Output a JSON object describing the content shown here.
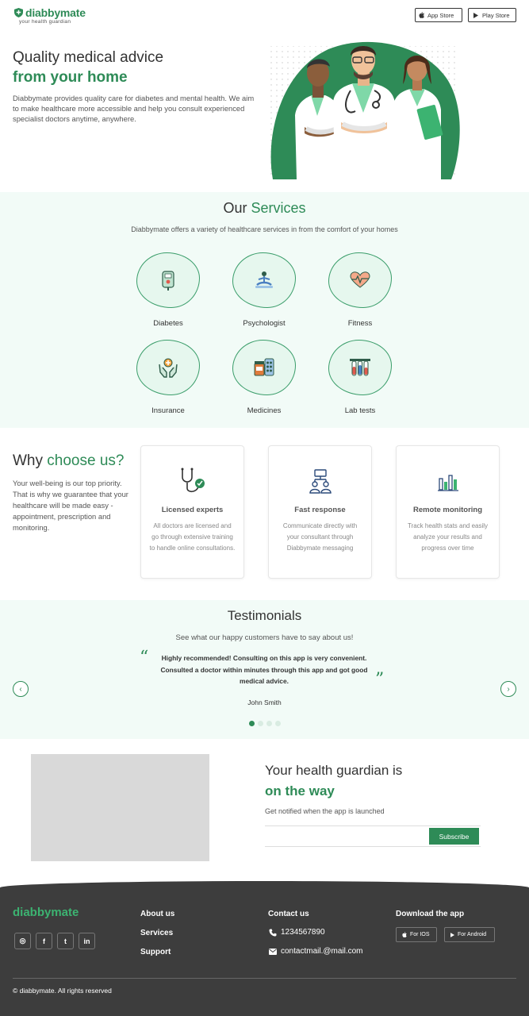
{
  "header": {
    "logo": {
      "prefix": "diabby",
      "suffix": "mate"
    },
    "tagline": "your health guardian",
    "app_store": "App Store",
    "play_store": "Play Store"
  },
  "hero": {
    "title_line1": "Quality medical advice",
    "title_line2": "from your home",
    "description": "Diabbymate provides quality care for diabetes and mental health. We aim to make healthcare more accessible and help you consult experienced specialist doctors anytime, anywhere."
  },
  "services": {
    "title_plain": "Our ",
    "title_accent": "Services",
    "subtitle": "Diabbymate offers a variety of healthcare services in from the comfort of your homes",
    "items": [
      {
        "label": "Diabetes",
        "icon": "glucometer-icon"
      },
      {
        "label": "Psychologist",
        "icon": "meditation-icon"
      },
      {
        "label": "Fitness",
        "icon": "heartbeat-icon"
      },
      {
        "label": "Insurance",
        "icon": "insurance-hands-icon"
      },
      {
        "label": "Medicines",
        "icon": "medicines-icon"
      },
      {
        "label": "Lab tests",
        "icon": "test-tubes-icon"
      }
    ]
  },
  "why": {
    "title_plain": "Why ",
    "title_accent": "choose us?",
    "description": "Your well-being is our top priority. That is why we guarantee that your healthcare will be made easy - appointment, prescription and monitoring.",
    "cards": [
      {
        "title": "Licensed experts",
        "text": "All doctors are licensed and go through extensive training to handle online consultations.",
        "icon": "stethoscope-icon"
      },
      {
        "title": "Fast response",
        "text": "Communicate directly with your consultant through Diabbymate messaging",
        "icon": "team-network-icon"
      },
      {
        "title": "Remote monitoring",
        "text": "Track health stats and easily analyze your results and progress over time",
        "icon": "bar-chart-icon"
      }
    ]
  },
  "testimonials": {
    "title": "Testimonials",
    "subtitle": "See what our happy customers have to say about us!",
    "quote": "Highly recommended! Consulting on this app is very convenient. Consulted a doctor within minutes through this app and got good medical advice.",
    "author": "John Smith",
    "open_quote": "“",
    "close_quote": "”",
    "prev": "‹",
    "next": "›",
    "slides": 4,
    "active_slide": 1
  },
  "subscribe": {
    "title_line1": "Your health guardian is",
    "title_line2": "on the way",
    "note": "Get notified when the app is launched",
    "button": "Subscribe"
  },
  "footer": {
    "logo": "diabbymate",
    "socials": [
      {
        "icon": "instagram-icon",
        "glyph": "◎"
      },
      {
        "icon": "facebook-icon",
        "glyph": "f"
      },
      {
        "icon": "twitter-icon",
        "glyph": "t"
      },
      {
        "icon": "linkedin-icon",
        "glyph": "in"
      }
    ],
    "links": [
      "About us",
      "Services",
      "Support"
    ],
    "contact_heading": "Contact us",
    "phone": "1234567890",
    "email": "contactmail.@mail.com",
    "download_heading": "Download the app",
    "ios": "For IOS",
    "android": "For Android",
    "copyright": "© diabbymate. All rights reserved"
  },
  "colors": {
    "brand_green": "#2e8b57",
    "light_green_bg": "#f2fbf7",
    "footer_bg": "#3d3d3d"
  }
}
